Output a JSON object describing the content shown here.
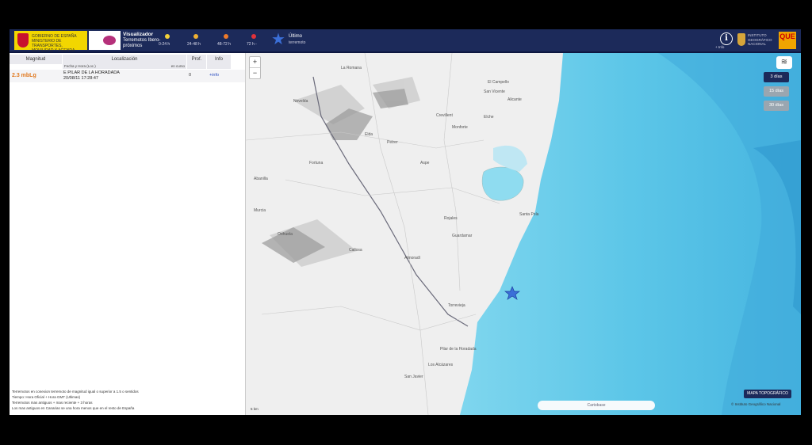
{
  "header": {
    "gov_text": "GOBIERNO DE ESPAÑA MINISTERIO DE TRANSPORTES, MOVILIDAD Y AGENDA URBANA",
    "app_title": "Visualizador",
    "app_subtitle": "Terremotos Ibero-próximos",
    "legend": [
      {
        "label": "0-24 h",
        "color": "#f2d13a"
      },
      {
        "label": "24-48 h",
        "color": "#f0b032"
      },
      {
        "label": "48-72 h",
        "color": "#ee7a2a"
      },
      {
        "label": "72 h -",
        "color": "#e0323a"
      }
    ],
    "last_label": "Último",
    "last_sub": "terremoto",
    "info_label": "+ Info",
    "inst_text": "INSTITUTO GEOGRÁFICO NACIONAL",
    "que_label": "QUE"
  },
  "table": {
    "col_mag": "Magnitud",
    "col_loc": "Localización",
    "sub_loc_date": "Fecha y Hora (Loc.)",
    "sub_loc_region": "en curso",
    "col_depth": "Prof.",
    "col_info": "Info",
    "rows": [
      {
        "mag": "2.3 mbLg",
        "place": "E PILAR DE LA HORADADA",
        "datetime": "20/08/11 17:28:47",
        "depth": "0",
        "info": "+info"
      }
    ],
    "notes": [
      "Terremotos en conexion terremoto de magnitud igual o superior a 1.5 o sentidos",
      "Tiempo: Hora Oficial + Hora GMT (Ultimas)",
      "Terremotos mas antiguos + mas reciente + 3 horas",
      "Los mas antiguos en Canarias se una hora menos que en el resto de España"
    ]
  },
  "map": {
    "zoom_in": "+",
    "zoom_out": "−",
    "time_buttons": [
      {
        "label": "3 días",
        "active": true
      },
      {
        "label": "15 días",
        "active": false
      },
      {
        "label": "30 días",
        "active": false
      }
    ],
    "layers_icon": "layers-icon",
    "map_button": "MAPA TOPOGRÁFICO",
    "attribution": "© Instituto Geográfico Nacional",
    "bottom_bar": "Cartobase",
    "scale": "5 km",
    "towns": [
      "La Romana",
      "Novelda",
      "Elda",
      "Petrer",
      "Monforte",
      "Aspe",
      "Orihuela",
      "Crevillent",
      "Elche",
      "Santa Pola",
      "Torrevieja",
      "Callosa",
      "Almoradí",
      "Rojales",
      "Guardamar",
      "Pilar de la Horadada",
      "San Javier",
      "Los Alcázares",
      "Murcia",
      "Alicante",
      "San Vicente",
      "El Campello",
      "Abanilla",
      "Fortuna"
    ]
  }
}
